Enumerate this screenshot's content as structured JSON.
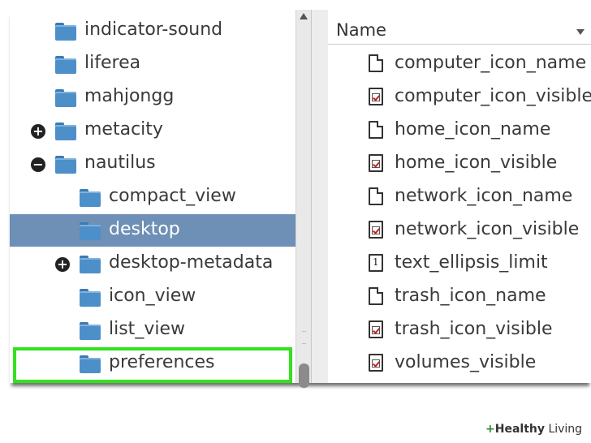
{
  "tree": {
    "items": [
      {
        "label": "indicator-sound",
        "expander": "",
        "selected": false
      },
      {
        "label": "liferea",
        "expander": "",
        "selected": false
      },
      {
        "label": "mahjongg",
        "expander": "",
        "selected": false
      },
      {
        "label": "metacity",
        "expander": "+",
        "selected": false
      },
      {
        "label": "nautilus",
        "expander": "−",
        "selected": false
      },
      {
        "label": "compact_view",
        "expander": "",
        "selected": false
      },
      {
        "label": "desktop",
        "expander": "",
        "selected": true
      },
      {
        "label": "desktop-metadata",
        "expander": "+",
        "selected": false
      },
      {
        "label": "icon_view",
        "expander": "",
        "selected": false
      },
      {
        "label": "list_view",
        "expander": "",
        "selected": false
      },
      {
        "label": "preferences",
        "expander": "",
        "selected": false
      }
    ]
  },
  "list": {
    "header": "Name",
    "items": [
      {
        "label": "computer_icon_name",
        "icon": "text-file-icon"
      },
      {
        "label": "computer_icon_visible",
        "icon": "checkbox-file-icon"
      },
      {
        "label": "home_icon_name",
        "icon": "text-file-icon"
      },
      {
        "label": "home_icon_visible",
        "icon": "checkbox-file-icon"
      },
      {
        "label": "network_icon_name",
        "icon": "text-file-icon"
      },
      {
        "label": "network_icon_visible",
        "icon": "checkbox-file-icon"
      },
      {
        "label": "text_ellipsis_limit",
        "icon": "integer-file-icon",
        "glyph": "1"
      },
      {
        "label": "trash_icon_name",
        "icon": "text-file-icon"
      },
      {
        "label": "trash_icon_visible",
        "icon": "checkbox-file-icon"
      },
      {
        "label": "volumes_visible",
        "icon": "checkbox-file-icon"
      }
    ]
  },
  "watermark": {
    "plus": "+",
    "part1": "Healthy",
    "part2": "Living"
  },
  "colors": {
    "selection": "#6e8fb6",
    "highlight": "#33e11f",
    "folder": "#4d8fc9"
  }
}
